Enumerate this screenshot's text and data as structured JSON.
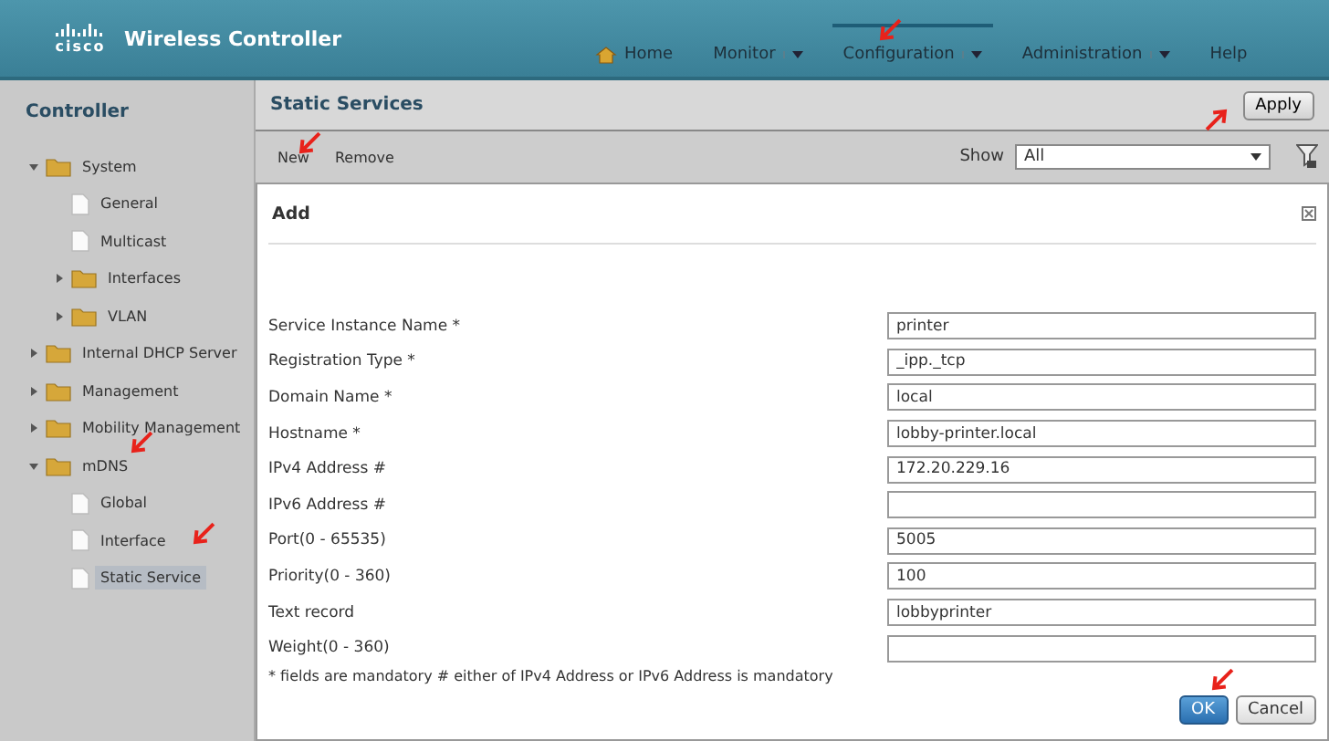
{
  "header": {
    "logo": "cisco",
    "product": "Wireless Controller",
    "nav": [
      {
        "label": "Home",
        "kind": "home",
        "selected": false
      },
      {
        "label": "Monitor",
        "kind": "menu",
        "selected": false
      },
      {
        "label": "Configuration",
        "kind": "menu",
        "selected": true
      },
      {
        "label": "Administration",
        "kind": "menu",
        "selected": false
      },
      {
        "label": "Help",
        "kind": "plain",
        "selected": false
      }
    ]
  },
  "sidebar": {
    "title": "Controller",
    "items": [
      {
        "label": "System",
        "kind": "folder",
        "expanded": true,
        "selected": false,
        "children": [
          {
            "label": "General",
            "kind": "page",
            "selected": false
          },
          {
            "label": "Multicast",
            "kind": "page",
            "selected": false
          },
          {
            "label": "Interfaces",
            "kind": "folder",
            "expanded": false,
            "selected": false
          },
          {
            "label": "VLAN",
            "kind": "folder",
            "expanded": false,
            "selected": false
          }
        ]
      },
      {
        "label": "Internal DHCP Server",
        "kind": "folder",
        "expanded": false,
        "selected": false
      },
      {
        "label": "Management",
        "kind": "folder",
        "expanded": false,
        "selected": false
      },
      {
        "label": "Mobility Management",
        "kind": "folder",
        "expanded": false,
        "selected": false
      },
      {
        "label": "mDNS",
        "kind": "folder",
        "expanded": true,
        "selected": false,
        "children": [
          {
            "label": "Global",
            "kind": "page",
            "selected": false
          },
          {
            "label": "Interface",
            "kind": "page",
            "selected": false
          },
          {
            "label": "Static Service",
            "kind": "page",
            "selected": true
          }
        ]
      }
    ]
  },
  "page": {
    "title": "Static Services",
    "apply": "Apply",
    "toolbar": [
      "New",
      "Remove"
    ],
    "show_label": "Show",
    "show_value": "All"
  },
  "dialog": {
    "title": "Add",
    "fields": [
      {
        "label": "Service Instance Name *",
        "value": "printer"
      },
      {
        "label": "Registration Type *",
        "value": "_ipp._tcp"
      },
      {
        "label": "Domain Name *",
        "value": "local"
      },
      {
        "label": "Hostname *",
        "value": "lobby-printer.local"
      },
      {
        "label": "IPv4 Address #",
        "value": "172.20.229.16"
      },
      {
        "label": "IPv6 Address #"
      },
      {
        "label": "Port(0 - 65535)",
        "value": "5005"
      },
      {
        "label": "Priority(0 - 360)",
        "value": "100"
      },
      {
        "label": "Text record",
        "value": "lobbyprinter"
      },
      {
        "label": "Weight(0 - 360)"
      }
    ],
    "note": "* fields are mandatory # either of IPv4 Address or IPv6 Address is mandatory",
    "buttons": [
      {
        "label": "OK",
        "kind": "primary"
      },
      {
        "label": "Cancel",
        "kind": "secondary"
      }
    ]
  }
}
